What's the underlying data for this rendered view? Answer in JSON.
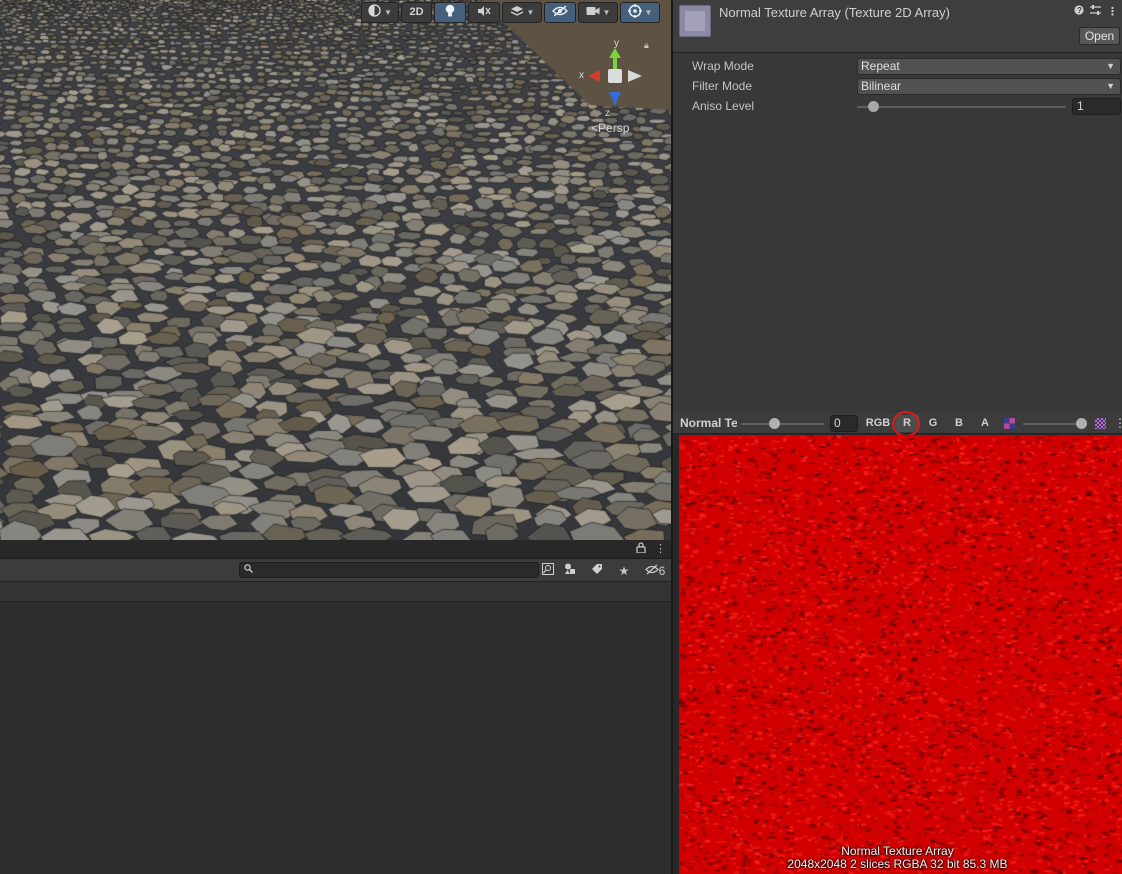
{
  "scene_toolbar": {
    "mode_2d_label": "2D",
    "icons": [
      "shading-mode-icon",
      "lighting-icon",
      "audio-mute-icon",
      "effects-icon",
      "hidden-objects-icon",
      "camera-icon",
      "gizmos-icon"
    ]
  },
  "scene_gizmo": {
    "axis_y": "y",
    "axis_x": "x",
    "axis_z": "z",
    "projection_label": "Persp"
  },
  "colors": {
    "active_button": "#46607c",
    "gizmo_y": "#7ad23c",
    "gizmo_x": "#d63a2a",
    "gizmo_z": "#3a6ad6",
    "preview_red": "#d10000",
    "highlight_circle": "#e01818"
  },
  "project_panel": {
    "search_placeholder": "",
    "hidden_count": "6"
  },
  "inspector": {
    "asset_title": "Normal Texture Array (Texture 2D Array)",
    "open_label": "Open",
    "wrap_mode": {
      "label": "Wrap Mode",
      "value": "Repeat"
    },
    "filter_mode": {
      "label": "Filter Mode",
      "value": "Bilinear"
    },
    "aniso_level": {
      "label": "Aniso Level",
      "value": "1"
    }
  },
  "preview": {
    "name_label": "Normal Texture Array",
    "slice_value": "0",
    "channels": [
      "RGB",
      "R",
      "G",
      "B",
      "A"
    ],
    "active_channel": "R",
    "caption_title": "Normal Texture Array",
    "caption_info": "2048x2048 2 slices RGBA 32 bit 85.3 MB"
  }
}
